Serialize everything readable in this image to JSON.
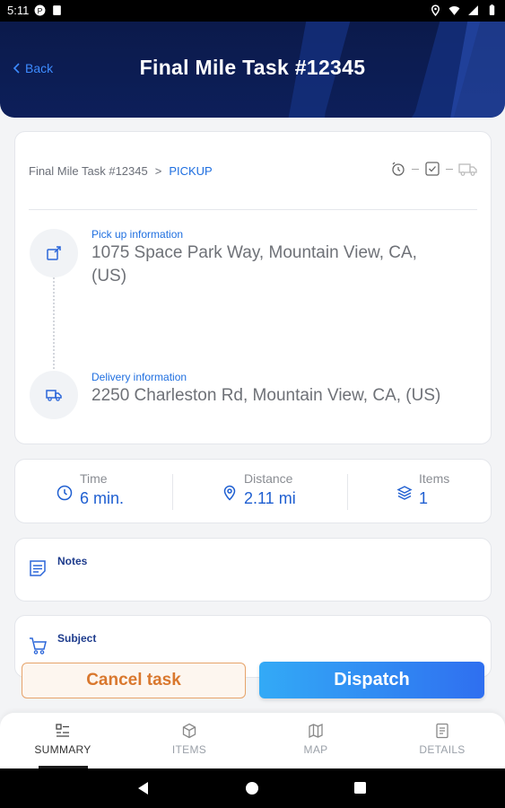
{
  "status_bar": {
    "time": "5:11"
  },
  "header": {
    "back_label": "Back",
    "title": "Final Mile Task #12345"
  },
  "route": {
    "breadcrumb_task": "Final Mile Task #12345",
    "breadcrumb_separator": ">",
    "breadcrumb_stage": "PICKUP",
    "pickup_label": "Pick up information",
    "pickup_address": "1075 Space Park Way, Mountain View, CA, (US)",
    "delivery_label": "Delivery information",
    "delivery_address": "2250 Charleston Rd, Mountain View, CA, (US)"
  },
  "stats": {
    "time_label": "Time",
    "time_value": "6 min.",
    "distance_label": "Distance",
    "distance_value": "2.11 mi",
    "items_label": "Items",
    "items_value": "1"
  },
  "notes": {
    "title": "Notes"
  },
  "subject": {
    "title": "Subject"
  },
  "actions": {
    "cancel_label": "Cancel task",
    "dispatch_label": "Dispatch"
  },
  "tabs": [
    {
      "label": "SUMMARY",
      "icon": "summary-icon",
      "active": true
    },
    {
      "label": "ITEMS",
      "icon": "cube-icon",
      "active": false
    },
    {
      "label": "MAP",
      "icon": "map-icon",
      "active": false
    },
    {
      "label": "DETAILS",
      "icon": "details-icon",
      "active": false
    }
  ],
  "colors": {
    "header_bg": "#0b1a4b",
    "accent_blue": "#1f6fe0",
    "cancel_orange": "#d9782e",
    "dispatch_gradient_start": "#33aaf6",
    "dispatch_gradient_end": "#2f6ff0"
  }
}
